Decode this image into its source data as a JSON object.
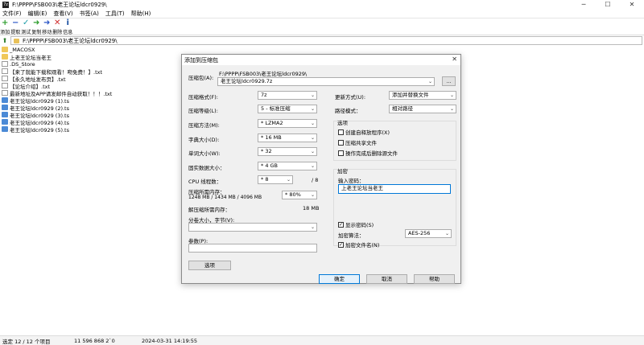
{
  "window": {
    "title": "F:\\PPPP\\FSB003\\老王论坛ldcr0929\\",
    "app_icon": "7z",
    "menu": [
      "文件(F)",
      "编辑(E)",
      "查看(V)",
      "书签(A)",
      "工具(T)",
      "帮助(H)"
    ]
  },
  "toolbar": {
    "buttons": [
      {
        "label": "添加",
        "icon": "plus-icon",
        "color": "#2e9e2e"
      },
      {
        "label": "提取",
        "icon": "minus-icon",
        "color": "#2a56c6"
      },
      {
        "label": "测试",
        "icon": "check-icon",
        "color": "#1e9ea7"
      },
      {
        "label": "复制",
        "icon": "copy-arrow-icon",
        "color": "#2e9e2e"
      },
      {
        "label": "移动",
        "icon": "move-arrow-icon",
        "color": "#2a56c6"
      },
      {
        "label": "删除",
        "icon": "delete-icon",
        "color": "#d02a2a"
      },
      {
        "label": "信息",
        "icon": "info-icon",
        "color": "#1a4fa0"
      }
    ]
  },
  "address": {
    "path": "F:\\PPPP\\FSB003\\老王论坛ldcr0929\\"
  },
  "files": [
    {
      "name": "_MACOSX",
      "type": "folder"
    },
    {
      "name": "上老王论坛当老王",
      "type": "folder"
    },
    {
      "name": ".DS_Store",
      "type": "file"
    },
    {
      "name": "【来了就能下载和观看！吻免费！】.txt",
      "type": "file"
    },
    {
      "name": "【永久地址发布页】.txt",
      "type": "file"
    },
    {
      "name": "【论坛介绍】.txt",
      "type": "file"
    },
    {
      "name": "最新地址及APP请发邮件自动获取！！！.txt",
      "type": "file"
    },
    {
      "name": "老王论坛ldcr0929 (1).ts",
      "type": "media"
    },
    {
      "name": "老王论坛ldcr0929 (2).ts",
      "type": "media"
    },
    {
      "name": "老王论坛ldcr0929 (3).ts",
      "type": "media"
    },
    {
      "name": "老王论坛ldcr0929 (4).ts",
      "type": "media"
    },
    {
      "name": "老王论坛ldcr0929 (5).ts",
      "type": "media"
    }
  ],
  "status": {
    "selection": "选定 12 / 12 个项目",
    "size": "11 596 868 2`0",
    "datetime": "2024-03-31 14:19:55"
  },
  "dialog": {
    "title": "添加到压缩包",
    "archive_label": "压缩包(A):",
    "archive_dir": "F:\\PPPP\\FSB003\\老王论坛ldcr0929\\",
    "archive_name": "老王论坛ldcr0929.7z",
    "browse_label": "...",
    "format_label": "压缩格式(F):",
    "format_value": "7z",
    "level_label": "压缩等级(L):",
    "level_value": "5 - 标准压缩",
    "method_label": "压缩方法(M):",
    "method_value": "* LZMA2",
    "dict_label": "字典大小(D):",
    "dict_value": "* 16 MB",
    "word_label": "单词大小(W):",
    "word_value": "* 32",
    "solid_label": "固实数据大小：",
    "solid_value": "* 4 GB",
    "threads_label": "CPU 线程数：",
    "threads_value": "* 8",
    "threads_max": "/ 8",
    "mem_compress_label": "压缩所需内存：",
    "mem_compress_detail": "1248 MB / 1434 MB / 4096 MB",
    "mem_percent_value": "* 80%",
    "mem_decompress_label": "解压缩所需内存：",
    "mem_decompress_value": "18 MB",
    "split_label": "分卷大小，字节(V):",
    "split_value": "",
    "params_label": "参数(P):",
    "params_value": "",
    "options_button": "选项",
    "update_label": "更新方式(U):",
    "update_value": "添加并替换文件",
    "path_mode_label": "路径模式：",
    "path_mode_value": "相对路径",
    "options_group": "选项",
    "opt_sfx": "创建自释放程序(X)",
    "opt_shared": "压缩共享文件",
    "opt_delete": "操作完成后删除源文件",
    "encrypt_group": "加密",
    "password_label": "输入密码：",
    "password_value": "上老王论坛当老王",
    "show_password": "显示密码(S)",
    "enc_method_label": "加密算法：",
    "enc_method_value": "AES-256",
    "encrypt_names": "加密文件名(N)",
    "ok": "确定",
    "cancel": "取消",
    "help": "帮助"
  }
}
